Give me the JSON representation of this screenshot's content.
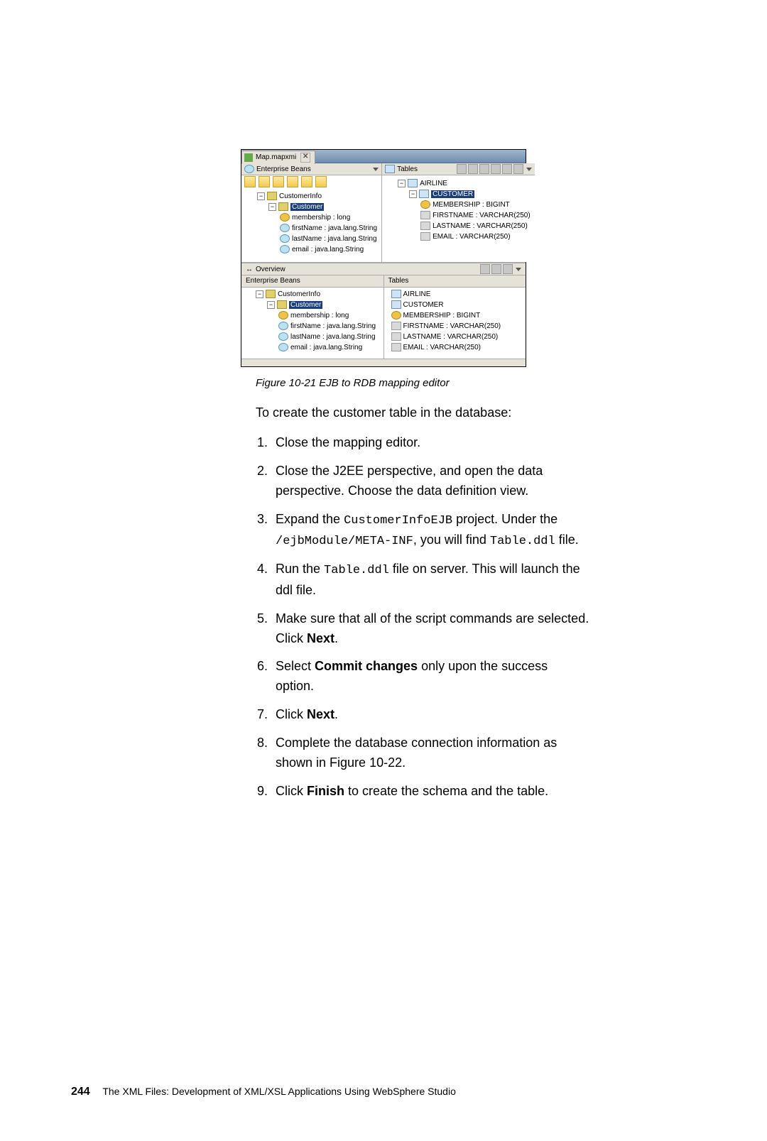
{
  "editor": {
    "tab_label": "Map.mapxmi",
    "left": {
      "header": "Enterprise Beans",
      "tree": {
        "root": "CustomerInfo",
        "entity": "Customer",
        "fields": [
          "membership : long",
          "firstName : java.lang.String",
          "lastName : java.lang.String",
          "email : java.lang.String"
        ]
      }
    },
    "right": {
      "header": "Tables",
      "tree": {
        "root": "AIRLINE",
        "table": "CUSTOMER",
        "columns": [
          "MEMBERSHIP : BIGINT",
          "FIRSTNAME : VARCHAR(250)",
          "LASTNAME : VARCHAR(250)",
          "EMAIL : VARCHAR(250)"
        ]
      }
    },
    "overview": {
      "label": "Overview",
      "left_header": "Enterprise Beans",
      "right_header": "Tables",
      "left": {
        "root": "CustomerInfo",
        "entity": "Customer",
        "fields": [
          "membership : long",
          "firstName : java.lang.String",
          "lastName : java.lang.String",
          "email : java.lang.String"
        ]
      },
      "right": {
        "root": "AIRLINE",
        "table": "CUSTOMER",
        "columns": [
          "MEMBERSHIP : BIGINT",
          "FIRSTNAME : VARCHAR(250)",
          "LASTNAME : VARCHAR(250)",
          "EMAIL : VARCHAR(250)"
        ]
      }
    }
  },
  "caption": "Figure 10-21   EJB to RDB mapping editor",
  "intro": "To create the customer table in the database:",
  "steps": {
    "s1": "Close the mapping editor.",
    "s2": "Close the J2EE perspective, and open the data perspective. Choose the data definition view.",
    "s3a": "Expand the ",
    "s3b": "CustomerInfoEJB",
    "s3c": " project. Under the ",
    "s3d": "/ejbModule/META-INF",
    "s3e": ", you will find ",
    "s3f": "Table.ddl",
    "s3g": " file.",
    "s4a": "Run the ",
    "s4b": "Table.ddl",
    "s4c": " file on server. This will launch the ddl file.",
    "s5a": "Make sure that all of the script commands are selected. Click ",
    "s5b": "Next",
    "s5c": ".",
    "s6a": "Select ",
    "s6b": "Commit changes",
    "s6c": " only upon the success option.",
    "s7a": "Click ",
    "s7b": "Next",
    "s7c": ".",
    "s8": "Complete the database connection information as shown in Figure 10-22.",
    "s9a": "Click ",
    "s9b": "Finish",
    "s9c": " to create the schema and the table."
  },
  "footer": {
    "page": "244",
    "title": "The XML Files:   Development of XML/XSL Applications Using WebSphere Studio"
  }
}
